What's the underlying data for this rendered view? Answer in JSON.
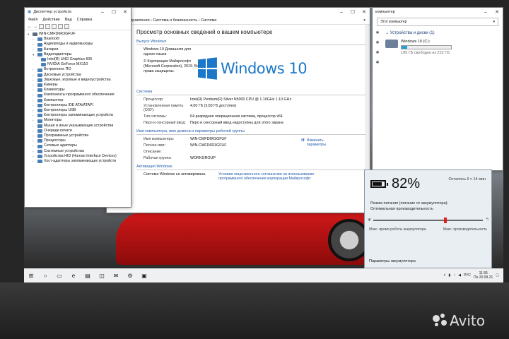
{
  "device_manager": {
    "title": "Диспетчер устройств",
    "menu": [
      "Файл",
      "Действие",
      "Вид",
      "Справка"
    ],
    "root": "WIN-CMFD6R3GFUF",
    "categories": [
      {
        "label": "Bluetooth"
      },
      {
        "label": "Аудиовходы и аудиовыходы"
      },
      {
        "label": "Батареи"
      },
      {
        "label": "Видеоадаптеры",
        "expanded": true,
        "children": [
          "Intel(R) UHD Graphics 605",
          "NVIDIA GeForce MX110"
        ]
      },
      {
        "label": "Встроенное ПО"
      },
      {
        "label": "Дисковые устройства"
      },
      {
        "label": "Звуковые, игровые и видеоустройства"
      },
      {
        "label": "Камеры"
      },
      {
        "label": "Клавиатуры"
      },
      {
        "label": "Компоненты программного обеспечения"
      },
      {
        "label": "Компьютер"
      },
      {
        "label": "Контроллеры IDE ATA/ATAPI"
      },
      {
        "label": "Контроллеры USB"
      },
      {
        "label": "Контроллеры запоминающих устройств"
      },
      {
        "label": "Мониторы"
      },
      {
        "label": "Мыши и иные указывающие устройства"
      },
      {
        "label": "Очереди печати"
      },
      {
        "label": "Программные устройства"
      },
      {
        "label": "Процессоры"
      },
      {
        "label": "Сетевые адаптеры"
      },
      {
        "label": "Системные устройства"
      },
      {
        "label": "Устройства HID (Human Interface Devices)"
      },
      {
        "label": "Хост-адаптеры запоминающих устройств"
      }
    ]
  },
  "system": {
    "breadcrumb": "анель управления  ›  Система и безопасность  ›  Система",
    "left_link": "ры",
    "heading": "Просмотр основных сведений о вашем компьютере",
    "edition_section": "Выпуск Windows",
    "edition_name": "Windows 10 Домашняя для одного языка",
    "copyright": "© Корпорация Майкрософт (Microsoft Corporation), 2019. Все права защищены.",
    "logo_text": "Windows 10",
    "system_section": "Система",
    "specs": [
      {
        "k": "Процессор:",
        "v": "Intel(R) Pentium(R) Silver N5000 CPU @ 1.10GHz   1.10 GHz"
      },
      {
        "k": "Установленная память (ОЗУ):",
        "v": "4,00 ГБ (3,83 ГБ доступно)"
      },
      {
        "k": "Тип системы:",
        "v": "64-разрядная операционная система, процессор x64"
      },
      {
        "k": "Перо и сенсорный ввод:",
        "v": "Перо и сенсорный ввод недоступны для этого экрана"
      }
    ],
    "name_section": "Имя компьютера, имя домена и параметры рабочей группы",
    "name_rows": [
      {
        "k": "Имя компьютера:",
        "v": "WIN-CMFD6R3GFUF"
      },
      {
        "k": "Полное имя:",
        "v": "WIN-CMFD6R3GFUF"
      },
      {
        "k": "Описание:",
        "v": ""
      },
      {
        "k": "Рабочая группа:",
        "v": "WORKGROUP"
      }
    ],
    "change_settings": "Изменить параметры",
    "activation_section": "Активация Windows",
    "activation_status": "Система Windows не активирована.",
    "license_link": "Условия лицензионного соглашения на использование программного обеспечения корпорации Майкрософт"
  },
  "explorer": {
    "title": "компьютер",
    "address": "Этот компьютер",
    "section": "Устройства и диски (1)",
    "drive_name": "Windows 10 (C:)",
    "drive_free": "195 ГБ свободно из 222 ГБ",
    "used_fraction": 0.12
  },
  "battery": {
    "percent": "82%",
    "percent_value": 0.82,
    "remaining": "Осталось 6 ч 14 мин",
    "mode_label": "Режим питания (питание от аккумулятора):",
    "mode_value": "Оптимальная производительность",
    "slider_position": 0.66,
    "left_label": "Макс. время работы аккумулятора",
    "right_label": "Макс. производительность",
    "settings_link": "Параметры аккумулятора"
  },
  "taskbar": {
    "lang": "РУС",
    "time": "11:35",
    "date": "Пн 20.09.21"
  },
  "watermark": "Avito"
}
